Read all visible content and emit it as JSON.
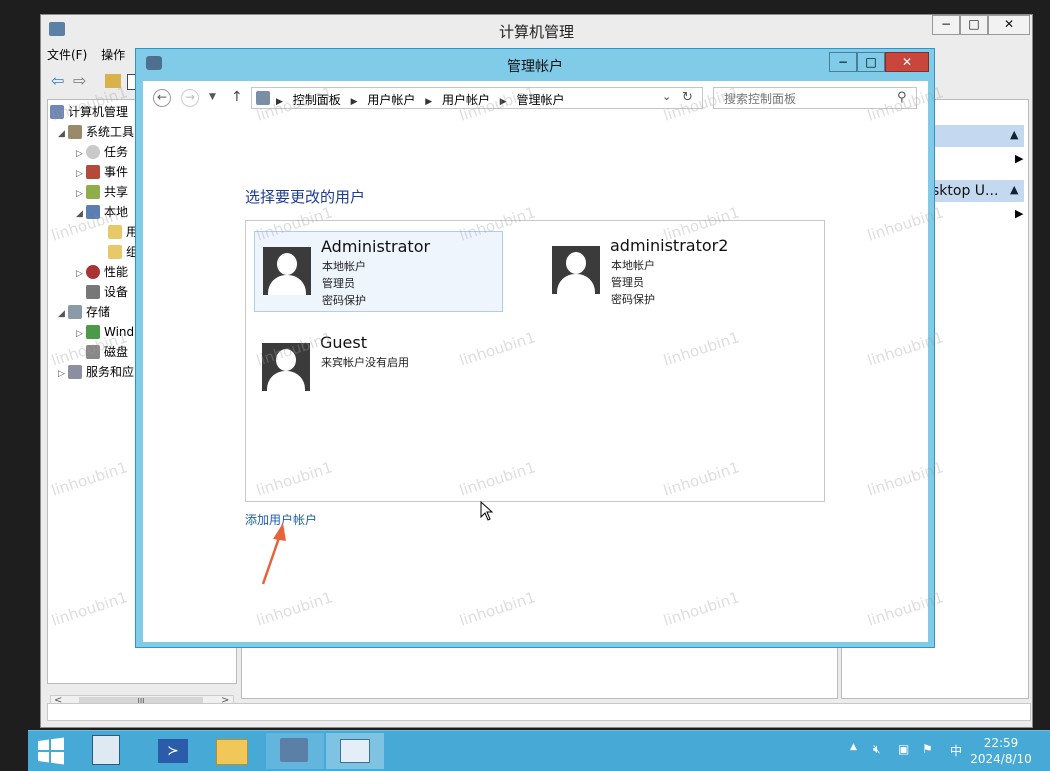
{
  "background_window": {
    "title": "计算机管理",
    "menu": [
      "文件(F)",
      "操作"
    ],
    "tree": [
      {
        "label": "计算机管理",
        "level": 0
      },
      {
        "label": "系统工具",
        "level": 1
      },
      {
        "label": "任务",
        "level": 2
      },
      {
        "label": "事件",
        "level": 2
      },
      {
        "label": "共享",
        "level": 2
      },
      {
        "label": "本地",
        "level": 2
      },
      {
        "label": "用",
        "level": 3
      },
      {
        "label": "组",
        "level": 3
      },
      {
        "label": "性能",
        "level": 2
      },
      {
        "label": "设备",
        "level": 2
      },
      {
        "label": "存储",
        "level": 1
      },
      {
        "label": "Wind",
        "level": 2
      },
      {
        "label": "磁盘",
        "level": 2
      },
      {
        "label": "服务和应",
        "level": 1
      }
    ],
    "actions_text": "sktop U...",
    "scroll_text": "III"
  },
  "dialog": {
    "title": "管理帐户",
    "breadcrumbs": [
      "控制面板",
      "用户帐户",
      "用户帐户",
      "管理帐户"
    ],
    "search_placeholder": "搜索控制面板",
    "heading": "选择要更改的用户",
    "users": [
      {
        "name": "Administrator",
        "lines": [
          "本地帐户",
          "管理员",
          "密码保护"
        ],
        "selected": true
      },
      {
        "name": "administrator2",
        "lines": [
          "本地帐户",
          "管理员",
          "密码保护"
        ],
        "selected": false
      },
      {
        "name": "Guest",
        "lines": [
          "来宾帐户没有启用"
        ],
        "selected": false
      }
    ],
    "add_link": "添加用户帐户"
  },
  "taskbar": {
    "time": "22:59",
    "date": "2024/8/10",
    "ime": "中"
  },
  "watermark": "linhoubin1",
  "colors": {
    "dialog_frame": "#7fcbe8",
    "taskbar": "#47a9d6",
    "heading": "#1e3c91",
    "link": "#1a5fb4",
    "close_button": "#c9463d",
    "arrow": "#e8623a"
  }
}
